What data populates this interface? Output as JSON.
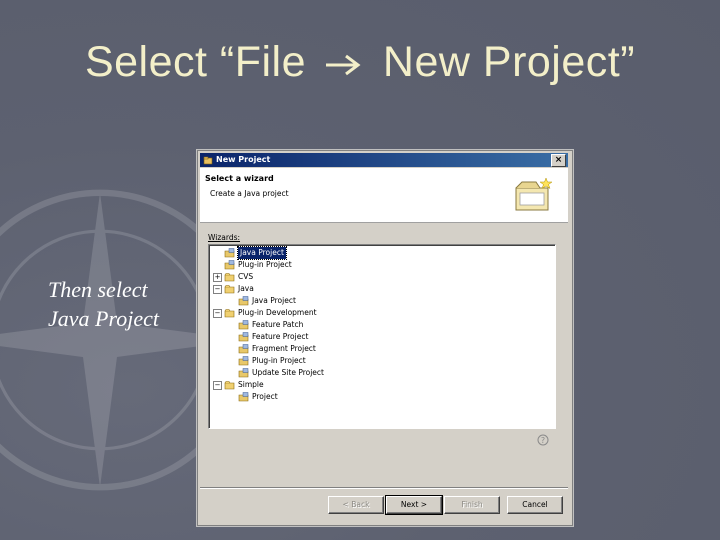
{
  "slide": {
    "title_part1": "Select “File",
    "title_part2": "New Project”",
    "side_note": "Then select Java Project"
  },
  "dialog": {
    "title": "New Project",
    "close_label": "×",
    "header_title": "Select a wizard",
    "header_desc": "Create a Java project",
    "wizards_label": "Wizards:",
    "tree": [
      {
        "label": "Java Project",
        "level": 1,
        "expander": "",
        "selected": true
      },
      {
        "label": "Plug-in Project",
        "level": 1,
        "expander": "",
        "selected": false
      },
      {
        "label": "CVS",
        "level": 1,
        "expander": "+",
        "selected": false
      },
      {
        "label": "Java",
        "level": 1,
        "expander": "−",
        "selected": false
      },
      {
        "label": "Java Project",
        "level": 2,
        "expander": "",
        "selected": false
      },
      {
        "label": "Plug-in Development",
        "level": 1,
        "expander": "−",
        "selected": false
      },
      {
        "label": "Feature Patch",
        "level": 2,
        "expander": "",
        "selected": false
      },
      {
        "label": "Feature Project",
        "level": 2,
        "expander": "",
        "selected": false
      },
      {
        "label": "Fragment Project",
        "level": 2,
        "expander": "",
        "selected": false
      },
      {
        "label": "Plug-in Project",
        "level": 2,
        "expander": "",
        "selected": false
      },
      {
        "label": "Update Site Project",
        "level": 2,
        "expander": "",
        "selected": false
      },
      {
        "label": "Simple",
        "level": 1,
        "expander": "−",
        "selected": false
      },
      {
        "label": "Project",
        "level": 2,
        "expander": "",
        "selected": false
      }
    ],
    "buttons": {
      "back": "< Back",
      "next": "Next >",
      "finish": "Finish",
      "cancel": "Cancel"
    }
  },
  "colors": {
    "title_text": "#f3efc9",
    "titlebar": "#0a246a",
    "dialog_face": "#d4d0c8"
  }
}
